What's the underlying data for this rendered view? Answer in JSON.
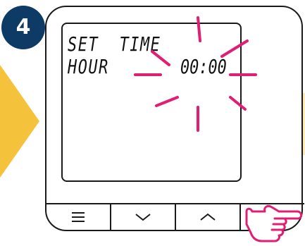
{
  "step": {
    "number": "4"
  },
  "lcd": {
    "line1": "SET  TIME",
    "line2": "HOUR",
    "time": "00:00"
  },
  "buttons": [
    {
      "name": "menu-button",
      "icon": "menu-icon"
    },
    {
      "name": "down-button",
      "icon": "chevron-down-icon"
    },
    {
      "name": "up-button",
      "icon": "chevron-up-icon"
    },
    {
      "name": "confirm-button",
      "icon": "check-icon"
    }
  ],
  "colors": {
    "badge": "#0e3a66",
    "arrow": "#f5c33b",
    "flash": "#e11d74",
    "hand": "#e11d74"
  }
}
